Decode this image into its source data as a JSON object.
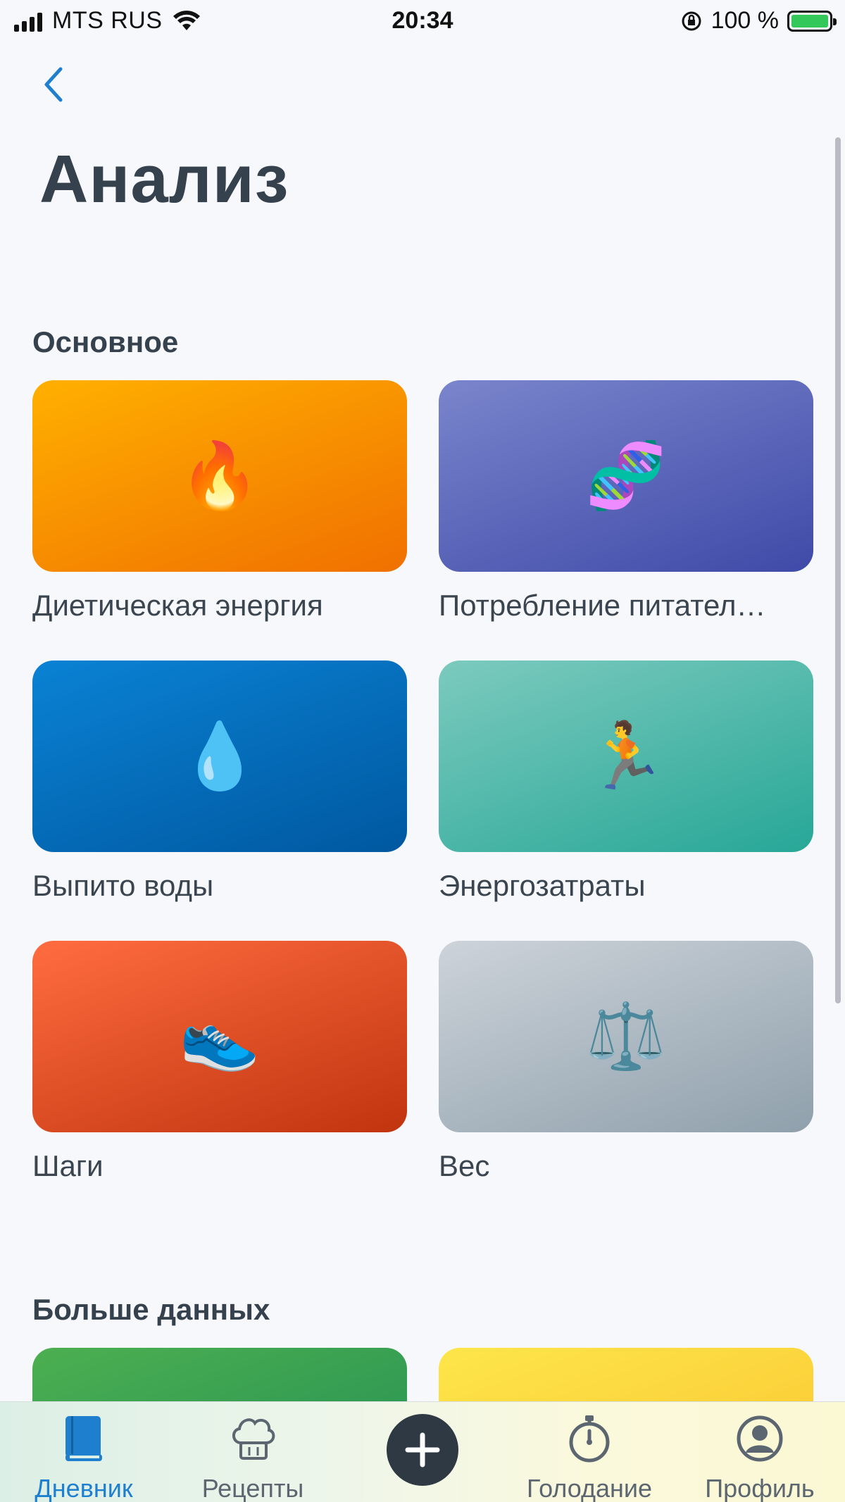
{
  "status_bar": {
    "carrier": "MTS RUS",
    "time": "20:34",
    "battery": "100 %"
  },
  "page": {
    "title": "Анализ"
  },
  "sections": [
    {
      "title": "Основное",
      "cards": [
        {
          "label": "Диетическая энергия",
          "icon": "fire-icon",
          "emoji": "🔥",
          "colors": [
            "#ffb000",
            "#f07000"
          ]
        },
        {
          "label": "Потребление питател…",
          "icon": "dna-icon",
          "emoji": "🧬",
          "colors": [
            "#7a85cc",
            "#3f4aa8"
          ]
        },
        {
          "label": "Выпито воды",
          "icon": "droplet-icon",
          "emoji": "💧",
          "colors": [
            "#0a82d4",
            "#0058a0"
          ]
        },
        {
          "label": "Энергозатраты",
          "icon": "runner-icon",
          "emoji": "🏃",
          "colors": [
            "#7ccabe",
            "#27a797"
          ]
        },
        {
          "label": "Шаги",
          "icon": "shoe-icon",
          "emoji": "👟",
          "colors": [
            "#ff6c40",
            "#c0340e"
          ]
        },
        {
          "label": "Вес",
          "icon": "scales-icon",
          "emoji": "⚖️",
          "colors": [
            "#cdd3d9",
            "#8fa0ac"
          ]
        }
      ]
    },
    {
      "title": "Больше данных",
      "cards": [
        {
          "colors": [
            "#4caf50",
            "#1e8c56"
          ]
        },
        {
          "colors": [
            "#fde64a",
            "#fbc02d"
          ]
        }
      ]
    }
  ],
  "tab_bar": {
    "items": [
      {
        "label": "Дневник",
        "icon": "diary-book-icon",
        "active": true
      },
      {
        "label": "Рецепты",
        "icon": "chef-hat-icon",
        "active": false
      },
      {
        "label": "Голодание",
        "icon": "stopwatch-icon",
        "active": false
      },
      {
        "label": "Профиль",
        "icon": "profile-icon",
        "active": false
      }
    ],
    "add_icon": "plus-icon"
  },
  "colors": {
    "accent": "#1f7fcf",
    "title": "#35414d",
    "background": "#f7f8fb"
  }
}
